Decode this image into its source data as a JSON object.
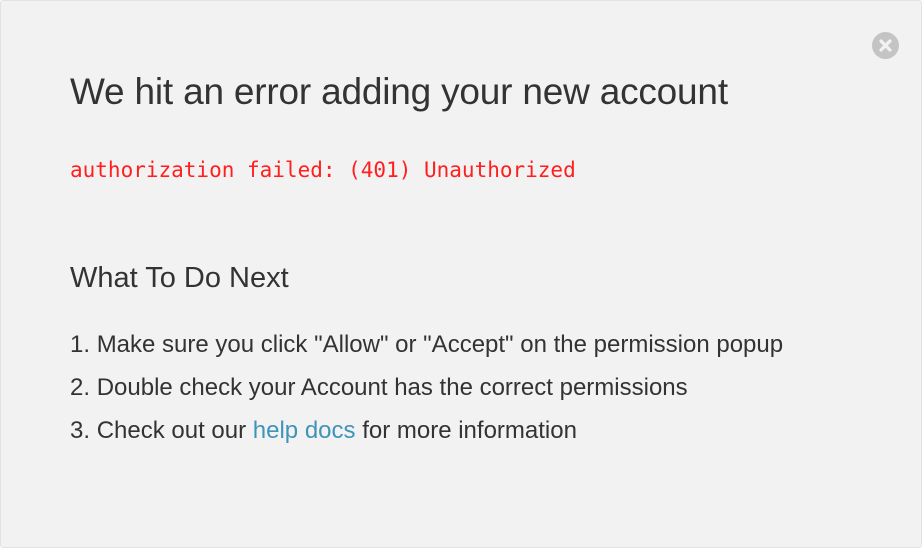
{
  "dialog": {
    "title": "We hit an error adding your new account",
    "error_message": "authorization failed: (401) Unauthorized",
    "next_heading": "What To Do Next",
    "steps": [
      {
        "number": "1.",
        "text": "Make sure you click \"Allow\" or \"Accept\" on the permission popup"
      },
      {
        "number": "2.",
        "text": "Double check your Account has the correct permissions"
      },
      {
        "number": "3.",
        "text_before": "Check out our",
        "link_text": "help docs",
        "text_after": "for more information"
      }
    ],
    "close_icon": "close-circle-icon"
  },
  "colors": {
    "background": "#f2f2f2",
    "text": "#333333",
    "error": "#ff1f1f",
    "link": "#3f94b8",
    "close_icon": "#c4c4c4"
  }
}
